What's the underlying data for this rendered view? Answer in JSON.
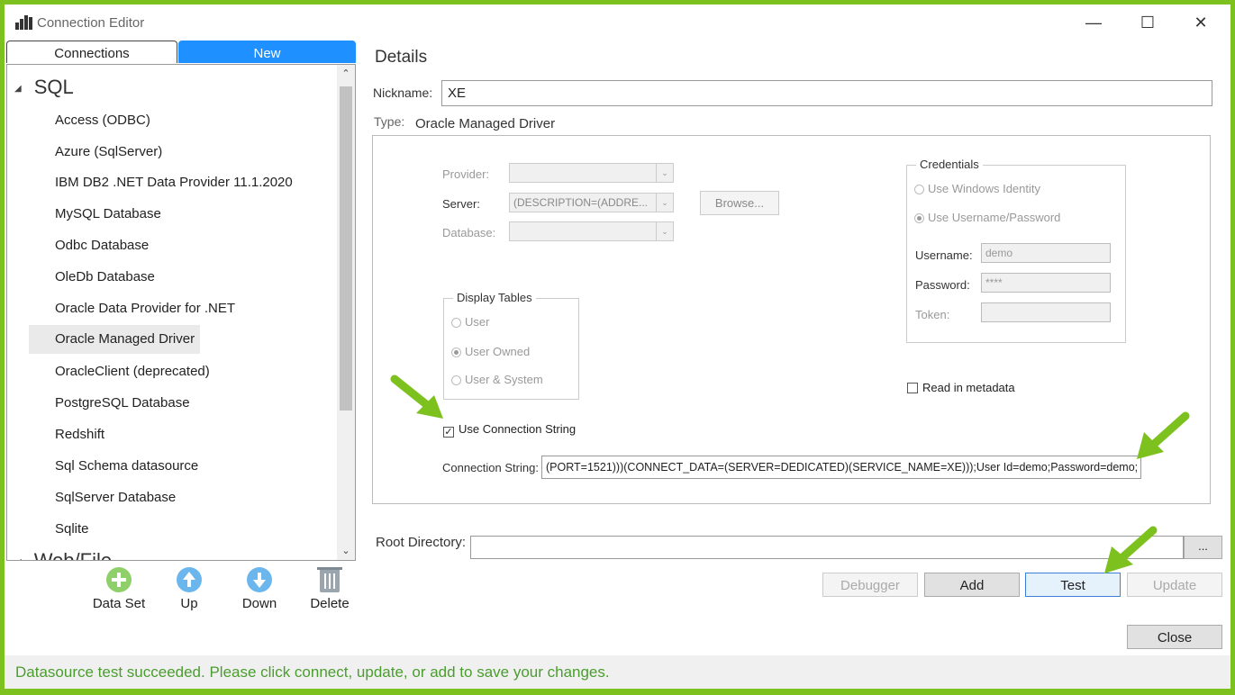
{
  "window": {
    "title": "Connection Editor"
  },
  "tabs": {
    "connections": "Connections",
    "new": "New"
  },
  "tree": {
    "group_sql": "SQL",
    "items": [
      "Access (ODBC)",
      "Azure (SqlServer)",
      "IBM DB2 .NET Data Provider 11.1.2020",
      "MySQL Database",
      "Odbc Database",
      "OleDb Database",
      "Oracle Data Provider for .NET",
      "Oracle Managed Driver",
      "OracleClient (deprecated)",
      "PostgreSQL Database",
      "Redshift",
      "Sql Schema datasource",
      "SqlServer Database",
      "Sqlite"
    ],
    "selected": "Oracle Managed Driver",
    "group_web": "Web/File"
  },
  "toolbar": {
    "dataset": "Data Set",
    "up": "Up",
    "down": "Down",
    "delete": "Delete"
  },
  "details": {
    "title": "Details",
    "nickname_label": "Nickname:",
    "nickname_value": "XE",
    "type_label": "Type:",
    "type_value": "Oracle Managed Driver",
    "provider_label": "Provider:",
    "server_label": "Server:",
    "server_value": "(DESCRIPTION=(ADDRE...",
    "database_label": "Database:",
    "browse_label": "Browse...",
    "display_tables": {
      "legend": "Display Tables",
      "user": "User",
      "user_owned": "User Owned",
      "user_system": "User & System"
    },
    "credentials": {
      "legend": "Credentials",
      "windows_identity": "Use Windows Identity",
      "username_password": "Use Username/Password",
      "username_label": "Username:",
      "username_value": "demo",
      "password_label": "Password:",
      "password_value": "****",
      "token_label": "Token:"
    },
    "read_metadata": "Read in metadata",
    "use_conn_string": "Use Connection String",
    "conn_string_label": "Connection String:",
    "conn_string_value": "(PORT=1521)))(CONNECT_DATA=(SERVER=DEDICATED)(SERVICE_NAME=XE)));User Id=demo;Password=demo;",
    "root_dir_label": "Root Directory:",
    "root_dir_browse": "..."
  },
  "buttons": {
    "debugger": "Debugger",
    "add": "Add",
    "test": "Test",
    "update": "Update",
    "close": "Close"
  },
  "status": "Datasource test succeeded. Please click connect, update, or add to save your changes.",
  "colors": {
    "accent": "#1e90ff",
    "frame": "#7dc11f",
    "status_text": "#4a9d2e"
  }
}
